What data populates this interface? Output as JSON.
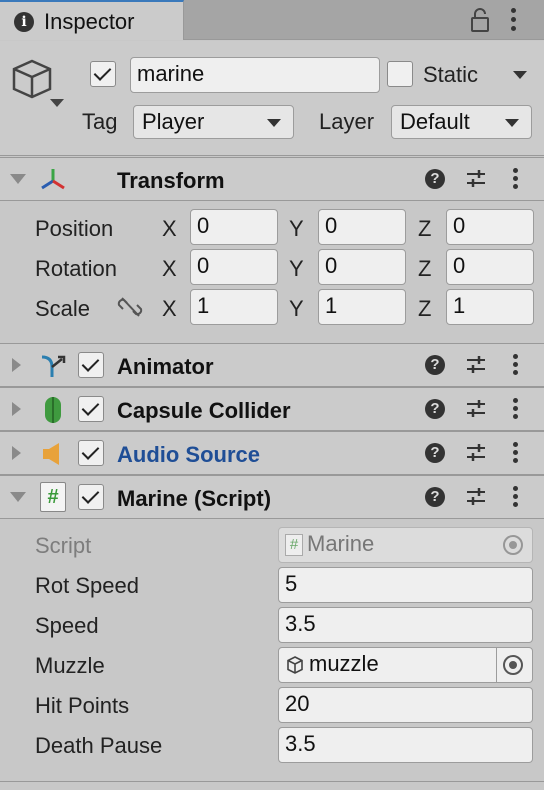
{
  "tab": {
    "title": "Inspector"
  },
  "object": {
    "active": true,
    "name": "marine",
    "static_label": "Static",
    "static_checked": false,
    "tag_label": "Tag",
    "tag_value": "Player",
    "layer_label": "Layer",
    "layer_value": "Default"
  },
  "transform": {
    "title": "Transform",
    "rows": [
      {
        "label": "Position",
        "x": "0",
        "y": "0",
        "z": "0"
      },
      {
        "label": "Rotation",
        "x": "0",
        "y": "0",
        "z": "0"
      },
      {
        "label": "Scale",
        "x": "1",
        "y": "1",
        "z": "1"
      }
    ],
    "axis_x": "X",
    "axis_y": "Y",
    "axis_z": "Z"
  },
  "components": [
    {
      "title": "Animator",
      "enabled": true,
      "icon": "animator-icon"
    },
    {
      "title": "Capsule Collider",
      "enabled": true,
      "icon": "capsule-collider-icon"
    },
    {
      "title": "Audio Source",
      "enabled": true,
      "icon": "audio-source-icon",
      "color": "#1f4e96"
    }
  ],
  "script_component": {
    "title": "Marine (Script)",
    "enabled": true,
    "fields": {
      "script_label": "Script",
      "script_value": "Marine",
      "rot_speed_label": "Rot Speed",
      "rot_speed_value": "5",
      "speed_label": "Speed",
      "speed_value": "3.5",
      "muzzle_label": "Muzzle",
      "muzzle_value": "muzzle",
      "hit_points_label": "Hit Points",
      "hit_points_value": "20",
      "death_pause_label": "Death Pause",
      "death_pause_value": "3.5"
    }
  },
  "colors": {
    "accent": "#3a79bb",
    "link": "#1f4e96",
    "panel": "#c8c8c8"
  }
}
